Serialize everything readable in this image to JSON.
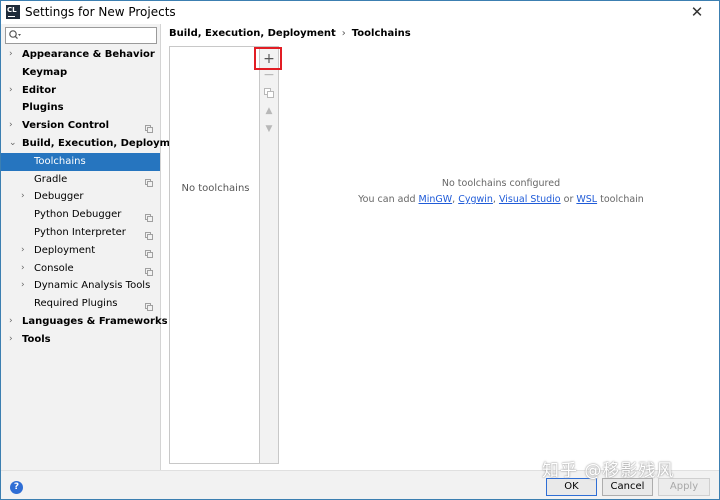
{
  "window": {
    "title": "Settings for New Projects",
    "app_icon_text": "CL",
    "close_glyph": "✕"
  },
  "search": {
    "value": "",
    "placeholder": ""
  },
  "sidebar": {
    "items": [
      {
        "label": "Appearance & Behavior",
        "level": 0,
        "expandable": true,
        "expanded": false,
        "bold": true,
        "selected": false,
        "copy_icon": false
      },
      {
        "label": "Keymap",
        "level": 0,
        "expandable": false,
        "bold": true,
        "selected": false,
        "copy_icon": false
      },
      {
        "label": "Editor",
        "level": 0,
        "expandable": true,
        "expanded": false,
        "bold": true,
        "selected": false,
        "copy_icon": false
      },
      {
        "label": "Plugins",
        "level": 0,
        "expandable": false,
        "bold": true,
        "selected": false,
        "copy_icon": false
      },
      {
        "label": "Version Control",
        "level": 0,
        "expandable": true,
        "expanded": false,
        "bold": true,
        "selected": false,
        "copy_icon": true
      },
      {
        "label": "Build, Execution, Deployment",
        "level": 0,
        "expandable": true,
        "expanded": true,
        "bold": true,
        "selected": false,
        "copy_icon": false
      },
      {
        "label": "Toolchains",
        "level": 1,
        "expandable": false,
        "bold": false,
        "selected": true,
        "copy_icon": false
      },
      {
        "label": "Gradle",
        "level": 1,
        "expandable": false,
        "bold": false,
        "selected": false,
        "copy_icon": true
      },
      {
        "label": "Debugger",
        "level": 1,
        "expandable": true,
        "expanded": false,
        "bold": false,
        "selected": false,
        "copy_icon": false
      },
      {
        "label": "Python Debugger",
        "level": 1,
        "expandable": false,
        "bold": false,
        "selected": false,
        "copy_icon": true
      },
      {
        "label": "Python Interpreter",
        "level": 1,
        "expandable": false,
        "bold": false,
        "selected": false,
        "copy_icon": true
      },
      {
        "label": "Deployment",
        "level": 1,
        "expandable": true,
        "expanded": false,
        "bold": false,
        "selected": false,
        "copy_icon": true
      },
      {
        "label": "Console",
        "level": 1,
        "expandable": true,
        "expanded": false,
        "bold": false,
        "selected": false,
        "copy_icon": true
      },
      {
        "label": "Dynamic Analysis Tools",
        "level": 1,
        "expandable": true,
        "expanded": false,
        "bold": false,
        "selected": false,
        "copy_icon": false
      },
      {
        "label": "Required Plugins",
        "level": 1,
        "expandable": false,
        "bold": false,
        "selected": false,
        "copy_icon": true
      },
      {
        "label": "Languages & Frameworks",
        "level": 0,
        "expandable": true,
        "expanded": false,
        "bold": true,
        "selected": false,
        "copy_icon": false
      },
      {
        "label": "Tools",
        "level": 0,
        "expandable": true,
        "expanded": false,
        "bold": true,
        "selected": false,
        "copy_icon": false
      }
    ]
  },
  "breadcrumb": {
    "parent": "Build, Execution, Deployment",
    "separator": "›",
    "current": "Toolchains"
  },
  "toolchains_list": {
    "empty_text": "No toolchains"
  },
  "toolbar": {
    "add_glyph": "+",
    "remove_glyph": "−",
    "up_glyph": "▲",
    "down_glyph": "▼"
  },
  "empty_state": {
    "title": "No toolchains configured",
    "prefix": "You can add ",
    "link_mingw": "MinGW",
    "comma1": ", ",
    "link_cygwin": "Cygwin",
    "comma2": ", ",
    "link_vs": "Visual Studio",
    "or": " or ",
    "link_wsl": "WSL",
    "suffix": " toolchain"
  },
  "footer": {
    "help_glyph": "?",
    "ok_label": "OK",
    "cancel_label": "Cancel",
    "apply_label": "Apply",
    "apply_enabled": false
  },
  "watermark": "知乎 @移影残风",
  "colors": {
    "selection": "#2675bf",
    "highlight_box": "#e21d24",
    "link": "#1f5bd8",
    "help_icon": "#2f6ed5"
  }
}
